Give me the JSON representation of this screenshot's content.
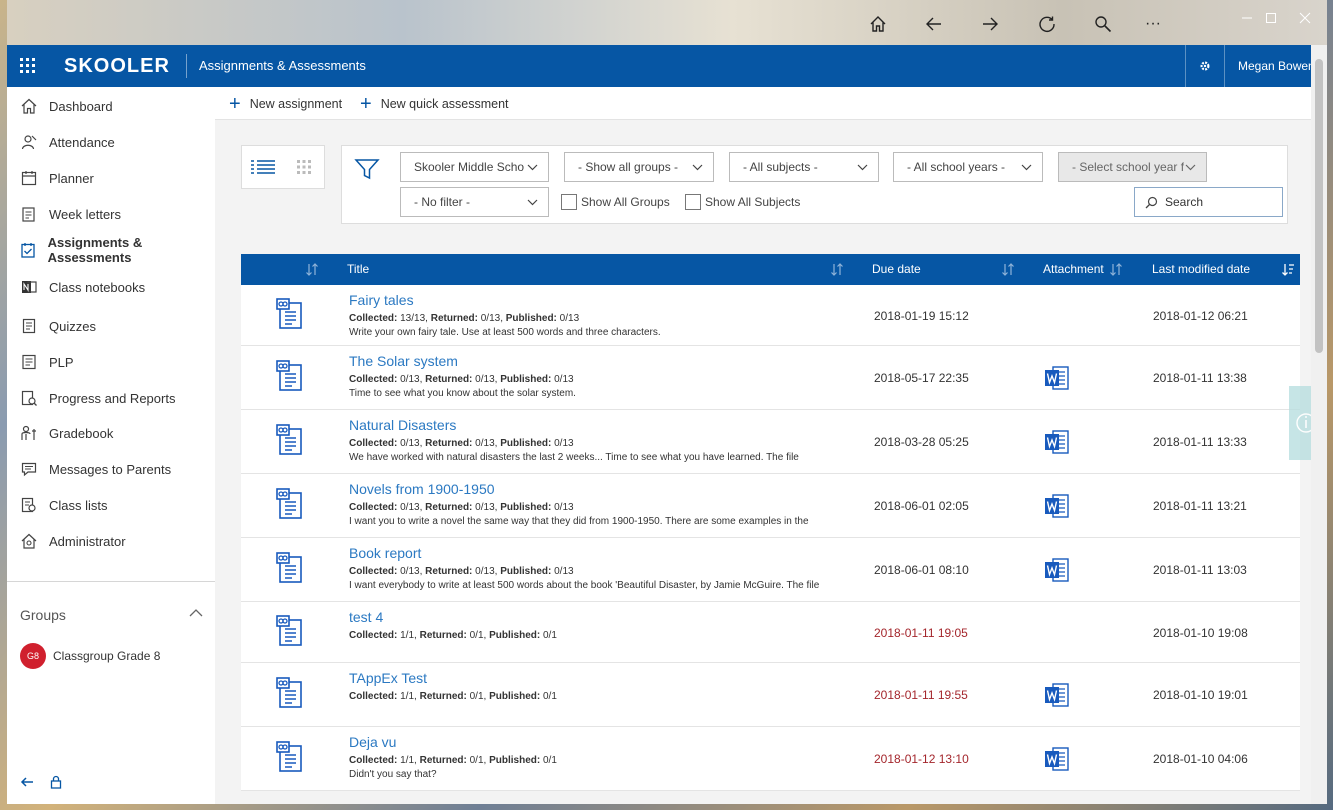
{
  "browser": {
    "nav_icons": [
      "home-icon",
      "back-icon",
      "forward-icon",
      "refresh-icon",
      "search-icon",
      "more-icon"
    ],
    "more_label": "···"
  },
  "appbar": {
    "brand": "SKOOLER",
    "title": "Assignments & Assessments",
    "user": "Megan Bowen"
  },
  "sidebar": {
    "items": [
      {
        "label": "Dashboard",
        "icon": "home-icon"
      },
      {
        "label": "Attendance",
        "icon": "attendance-icon"
      },
      {
        "label": "Planner",
        "icon": "planner-icon"
      },
      {
        "label": "Week letters",
        "icon": "week-letters-icon"
      },
      {
        "label": "Assignments & Assessments",
        "icon": "assignments-icon",
        "active": true
      },
      {
        "label": "Class notebooks",
        "icon": "onenote-icon"
      },
      {
        "label": "Quizzes",
        "icon": "quizzes-icon"
      },
      {
        "label": "PLP",
        "icon": "plp-icon"
      },
      {
        "label": "Progress and Reports",
        "icon": "reports-icon"
      },
      {
        "label": "Gradebook",
        "icon": "gradebook-icon"
      },
      {
        "label": "Messages to Parents",
        "icon": "messages-icon"
      },
      {
        "label": "Class lists",
        "icon": "class-lists-icon"
      },
      {
        "label": "Administrator",
        "icon": "administrator-icon"
      }
    ],
    "groups_header": "Groups",
    "groups": [
      {
        "avatar": "G8",
        "label": "Classgroup Grade 8"
      }
    ]
  },
  "commands": {
    "new_assignment": "New assignment",
    "new_quick_assessment": "New quick assessment"
  },
  "filters": {
    "school": "Skooler Middle School",
    "groups": "- Show all groups -",
    "subjects": "- All subjects -",
    "school_years": "- All school years -",
    "select_year": "- Select school year first -",
    "no_filter": "- No filter -",
    "show_all_groups": "Show All Groups",
    "show_all_subjects": "Show All Subjects",
    "search_placeholder": "Search"
  },
  "table": {
    "headers": {
      "title": "Title",
      "due": "Due date",
      "attachment": "Attachment",
      "modified": "Last modified date"
    },
    "labels": {
      "collected": "Collected:",
      "returned": "Returned:",
      "published": "Published:"
    },
    "rows": [
      {
        "title": "Fairy tales",
        "collected": "13/13",
        "returned": "0/13",
        "published": "0/13",
        "desc": "Write your own fairy tale. Use at least 500 words and three characters.",
        "due": "2018-01-19 15:12",
        "late": false,
        "attachment": false,
        "modified": "2018-01-12 06:21"
      },
      {
        "title": "The Solar system",
        "collected": "0/13",
        "returned": "0/13",
        "published": "0/13",
        "desc": "Time to see what you know about the solar system.",
        "due": "2018-05-17 22:35",
        "late": false,
        "attachment": true,
        "modified": "2018-01-11 13:38"
      },
      {
        "title": "Natural Disasters",
        "collected": "0/13",
        "returned": "0/13",
        "published": "0/13",
        "desc": "We have worked with natural disasters the last 2 weeks... Time to see what you have learned. The file",
        "due": "2018-03-28 05:25",
        "late": false,
        "attachment": true,
        "modified": "2018-01-11 13:33"
      },
      {
        "title": "Novels from 1900-1950",
        "collected": "0/13",
        "returned": "0/13",
        "published": "0/13",
        "desc": "I want you to write a novel the same way that they did from 1900-1950. There are some examples in the",
        "due": "2018-06-01 02:05",
        "late": false,
        "attachment": true,
        "modified": "2018-01-11 13:21"
      },
      {
        "title": "Book report",
        "collected": "0/13",
        "returned": "0/13",
        "published": "0/13",
        "desc": "I want everybody to write at least 500 words about the book 'Beautiful Disaster, by Jamie McGuire. The file",
        "due": "2018-06-01 08:10",
        "late": false,
        "attachment": true,
        "modified": "2018-01-11 13:03"
      },
      {
        "title": "test 4",
        "collected": "1/1",
        "returned": "0/1",
        "published": "0/1",
        "desc": "",
        "due": "2018-01-11 19:05",
        "late": true,
        "attachment": false,
        "modified": "2018-01-10 19:08"
      },
      {
        "title": "TAppEx Test",
        "collected": "1/1",
        "returned": "0/1",
        "published": "0/1",
        "desc": "",
        "due": "2018-01-11 19:55",
        "late": true,
        "attachment": true,
        "modified": "2018-01-10 19:01"
      },
      {
        "title": "Deja vu",
        "collected": "1/1",
        "returned": "0/1",
        "published": "0/1",
        "desc": "Didn't you say that?",
        "due": "2018-01-12 13:10",
        "late": true,
        "attachment": true,
        "modified": "2018-01-10 04:06"
      }
    ]
  },
  "colors": {
    "brand": "#0656a4",
    "link": "#2b79c2",
    "overdue": "#a4262c",
    "word": "#185abd",
    "avatar": "#d0202e"
  }
}
